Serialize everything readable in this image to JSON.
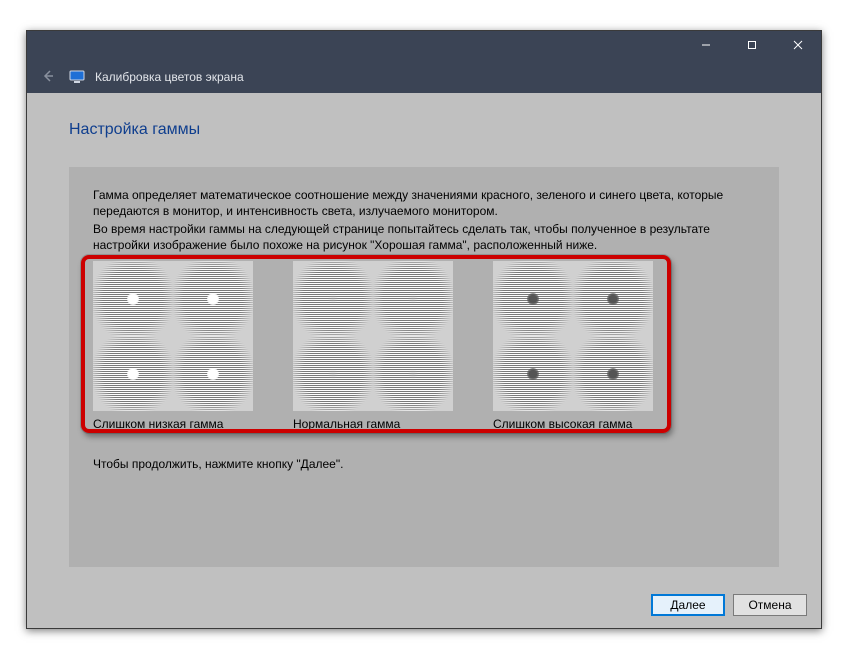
{
  "window": {
    "app_title": "Калибровка цветов экрана"
  },
  "heading": "Настройка гаммы",
  "body": {
    "p1": "Гамма определяет математическое соотношение между значениями красного, зеленого и синего цвета, которые передаются в монитор, и интенсивность света, излучаемого монитором.",
    "p2": "Во время настройки гаммы на следующей странице попытайтесь сделать так, чтобы полученное в результате настройки изображение было похоже на рисунок \"Хорошая гамма\", расположенный ниже.",
    "continue": "Чтобы продолжить, нажмите кнопку \"Далее\"."
  },
  "samples": {
    "low": "Слишком низкая гамма",
    "norm": "Нормальная гамма",
    "high": "Слишком высокая гамма"
  },
  "footer": {
    "next": "Далее",
    "cancel": "Отмена"
  },
  "icons": {
    "back": "←",
    "min": "—",
    "max": "□",
    "close": "✕"
  }
}
